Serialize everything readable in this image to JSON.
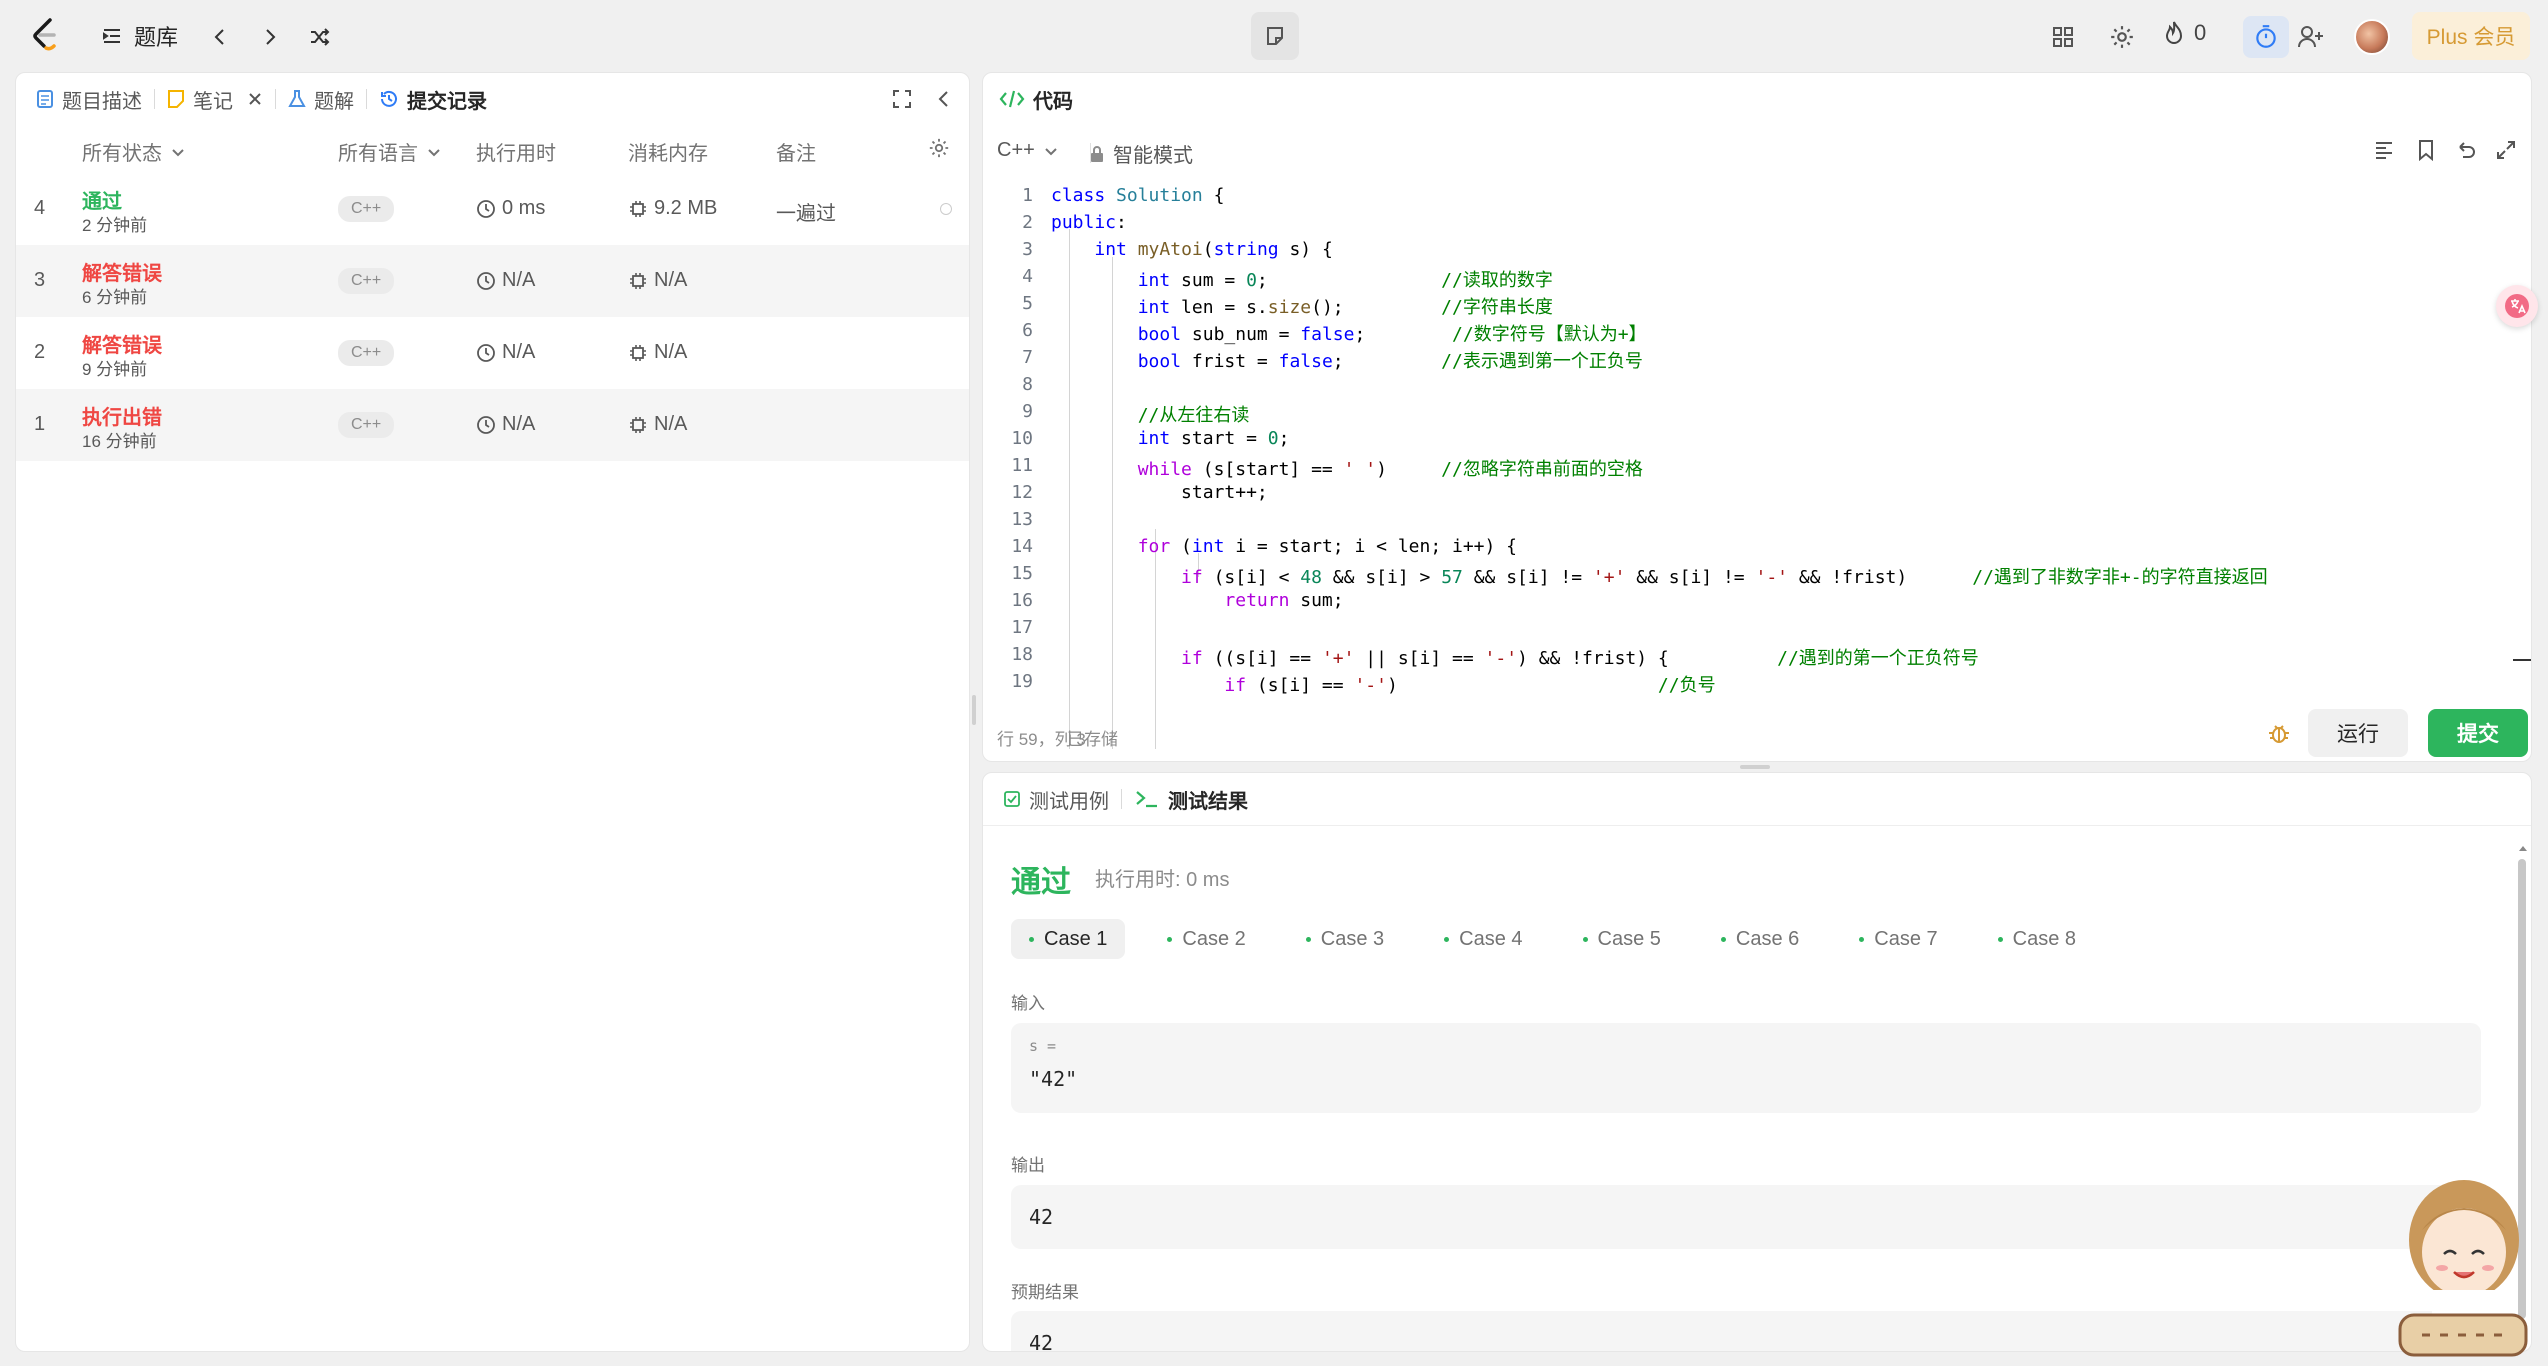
{
  "topbar": {
    "problem_list_label": "题库",
    "streak_count": "0",
    "plus_label": "Plus 会员",
    "icons": [
      "logo-icon",
      "list-icon",
      "chevron-left-icon",
      "chevron-right-icon",
      "shuffle-icon",
      "note-icon",
      "layout-icon",
      "gear-icon",
      "flame-icon",
      "timer-icon",
      "add-user-icon"
    ]
  },
  "left_panel": {
    "tabs": [
      {
        "label": "题目描述",
        "icon": "description-icon"
      },
      {
        "label": "笔记",
        "icon": "note-icon"
      },
      {
        "label": "题解",
        "icon": "flask-icon"
      },
      {
        "label": "提交记录",
        "icon": "history-icon"
      }
    ],
    "table": {
      "headers": {
        "status": "所有状态",
        "language": "所有语言",
        "runtime": "执行用时",
        "memory": "消耗内存",
        "notes": "备注"
      },
      "rows": [
        {
          "index": "4",
          "status": "通过",
          "status_kind": "accepted",
          "time_ago": "2 分钟前",
          "language": "C++",
          "runtime": "0 ms",
          "memory": "9.2 MB",
          "note": "一遍过"
        },
        {
          "index": "3",
          "status": "解答错误",
          "status_kind": "wrong",
          "time_ago": "6 分钟前",
          "language": "C++",
          "runtime": "N/A",
          "memory": "N/A",
          "note": ""
        },
        {
          "index": "2",
          "status": "解答错误",
          "status_kind": "wrong",
          "time_ago": "9 分钟前",
          "language": "C++",
          "runtime": "N/A",
          "memory": "N/A",
          "note": ""
        },
        {
          "index": "1",
          "status": "执行出错",
          "status_kind": "error",
          "time_ago": "16 分钟前",
          "language": "C++",
          "runtime": "N/A",
          "memory": "N/A",
          "note": ""
        }
      ]
    }
  },
  "code_panel": {
    "title": "代码",
    "language": "C++",
    "mode_label": "智能模式",
    "lines": [
      "class Solution {",
      "public:",
      "    int myAtoi(string s) {",
      "        int sum = 0;                //读取的数字",
      "        int len = s.size();         //字符串长度",
      "        bool sub_num = false;        //数字符号【默认为+】",
      "        bool frist = false;         //表示遇到第一个正负号",
      "",
      "        //从左往右读",
      "        int start = 0;",
      "        while (s[start] == ' ')     //忽略字符串前面的空格",
      "            start++;",
      "",
      "        for (int i = start; i < len; i++) {",
      "            if (s[i] < 48 && s[i] > 57 && s[i] != '+' && s[i] != '-' && !frist)      //遇到了非数字非+-的字符直接返回",
      "                return sum;",
      "",
      "            if ((s[i] == '+' || s[i] == '-') && !frist) {          //遇到的第一个正负符号",
      "                if (s[i] == '-')                        //负号"
    ],
    "cursor_position": "行 59，列 3",
    "save_status": "已存储",
    "run_label": "运行",
    "submit_label": "提交"
  },
  "result_panel": {
    "tabs": [
      {
        "label": "测试用例",
        "icon": "checkbox-icon"
      },
      {
        "label": "测试结果",
        "icon": "terminal-icon"
      }
    ],
    "verdict": "通过",
    "runtime_text": "执行用时: 0 ms",
    "cases": [
      "Case 1",
      "Case 2",
      "Case 3",
      "Case 4",
      "Case 5",
      "Case 6",
      "Case 7",
      "Case 8"
    ],
    "input_label": "输入",
    "input_var": "s =",
    "input_value": "\"42\"",
    "output_label": "输出",
    "output_value": "42",
    "expected_label": "预期结果",
    "expected_value": "42"
  },
  "colors": {
    "accepted": "#2db55d",
    "wrong": "#ef4743",
    "accent_blue": "#2f7cf6",
    "plus_gold": "#d69a34"
  }
}
